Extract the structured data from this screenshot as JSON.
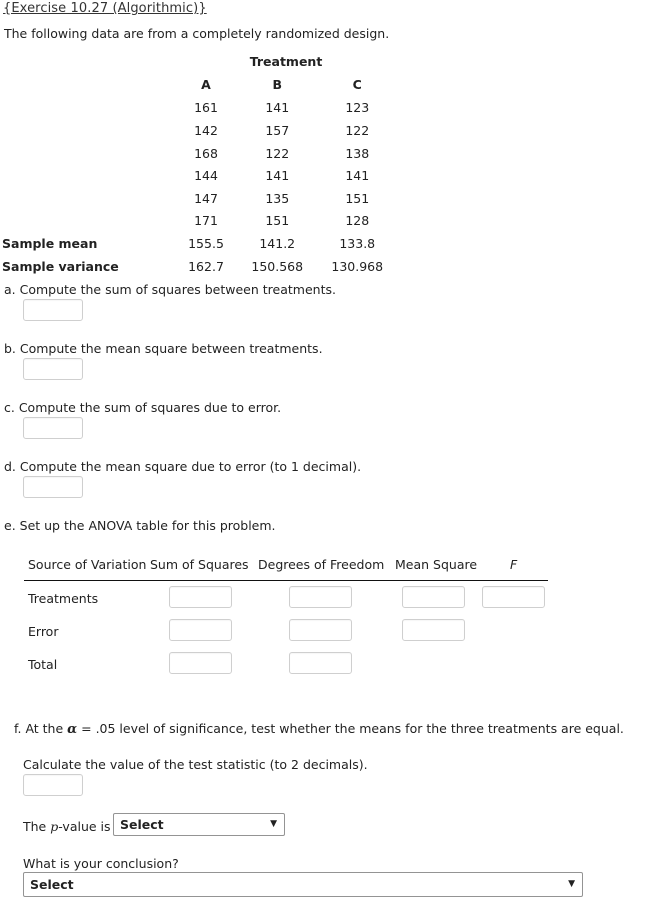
{
  "exercise": {
    "title": "{Exercise 10.27 (Algorithmic)}",
    "intro": "The following data are from a completely randomized design."
  },
  "data_table": {
    "group_header": "Treatment",
    "columns": [
      "A",
      "B",
      "C"
    ],
    "rows": [
      [
        "161",
        "141",
        "123"
      ],
      [
        "142",
        "157",
        "122"
      ],
      [
        "168",
        "122",
        "138"
      ],
      [
        "144",
        "141",
        "141"
      ],
      [
        "147",
        "135",
        "151"
      ],
      [
        "171",
        "151",
        "128"
      ]
    ],
    "summary": [
      {
        "label": "Sample mean",
        "values": [
          "155.5",
          "141.2",
          "133.8"
        ]
      },
      {
        "label": "Sample variance",
        "values": [
          "162.7",
          "150.568",
          "130.968"
        ]
      }
    ]
  },
  "questions": {
    "a": {
      "text": "a. Compute the sum of squares between treatments.",
      "value": ""
    },
    "b": {
      "text": "b. Compute the mean square between treatments.",
      "value": ""
    },
    "c": {
      "text": "c. Compute the sum of squares due to error.",
      "value": ""
    },
    "d": {
      "text": "d. Compute the mean square due to error (to 1 decimal).",
      "value": ""
    },
    "e": {
      "text": "e. Set up the ANOVA table for this problem."
    }
  },
  "anova": {
    "headers": {
      "source": "Source of Variation",
      "sum_of_squares": "Sum of Squares",
      "degrees_of_freedom": "Degrees of Freedom",
      "mean_square": "Mean Square",
      "f": "F"
    },
    "rows": [
      {
        "label": "Treatments",
        "ss": "",
        "df": "",
        "ms": "",
        "f": ""
      },
      {
        "label": "Error",
        "ss": "",
        "df": "",
        "ms": ""
      },
      {
        "label": "Total",
        "ss": "",
        "df": ""
      }
    ]
  },
  "part_f": {
    "prefix": "f. At the ",
    "alpha": "α",
    "suffix": " = .05 level of significance, test whether the means for the three treatments are equal.",
    "calc_text": "Calculate the value of the test statistic (to 2 decimals).",
    "test_statistic_value": "",
    "pvalue_prefix": "The ",
    "pvalue_italic": "p",
    "pvalue_suffix": "-value is",
    "pvalue_selected": "Select",
    "conclusion_label": "What is your conclusion?",
    "conclusion_selected": "Select",
    "dropdown_arrow": "▼"
  }
}
